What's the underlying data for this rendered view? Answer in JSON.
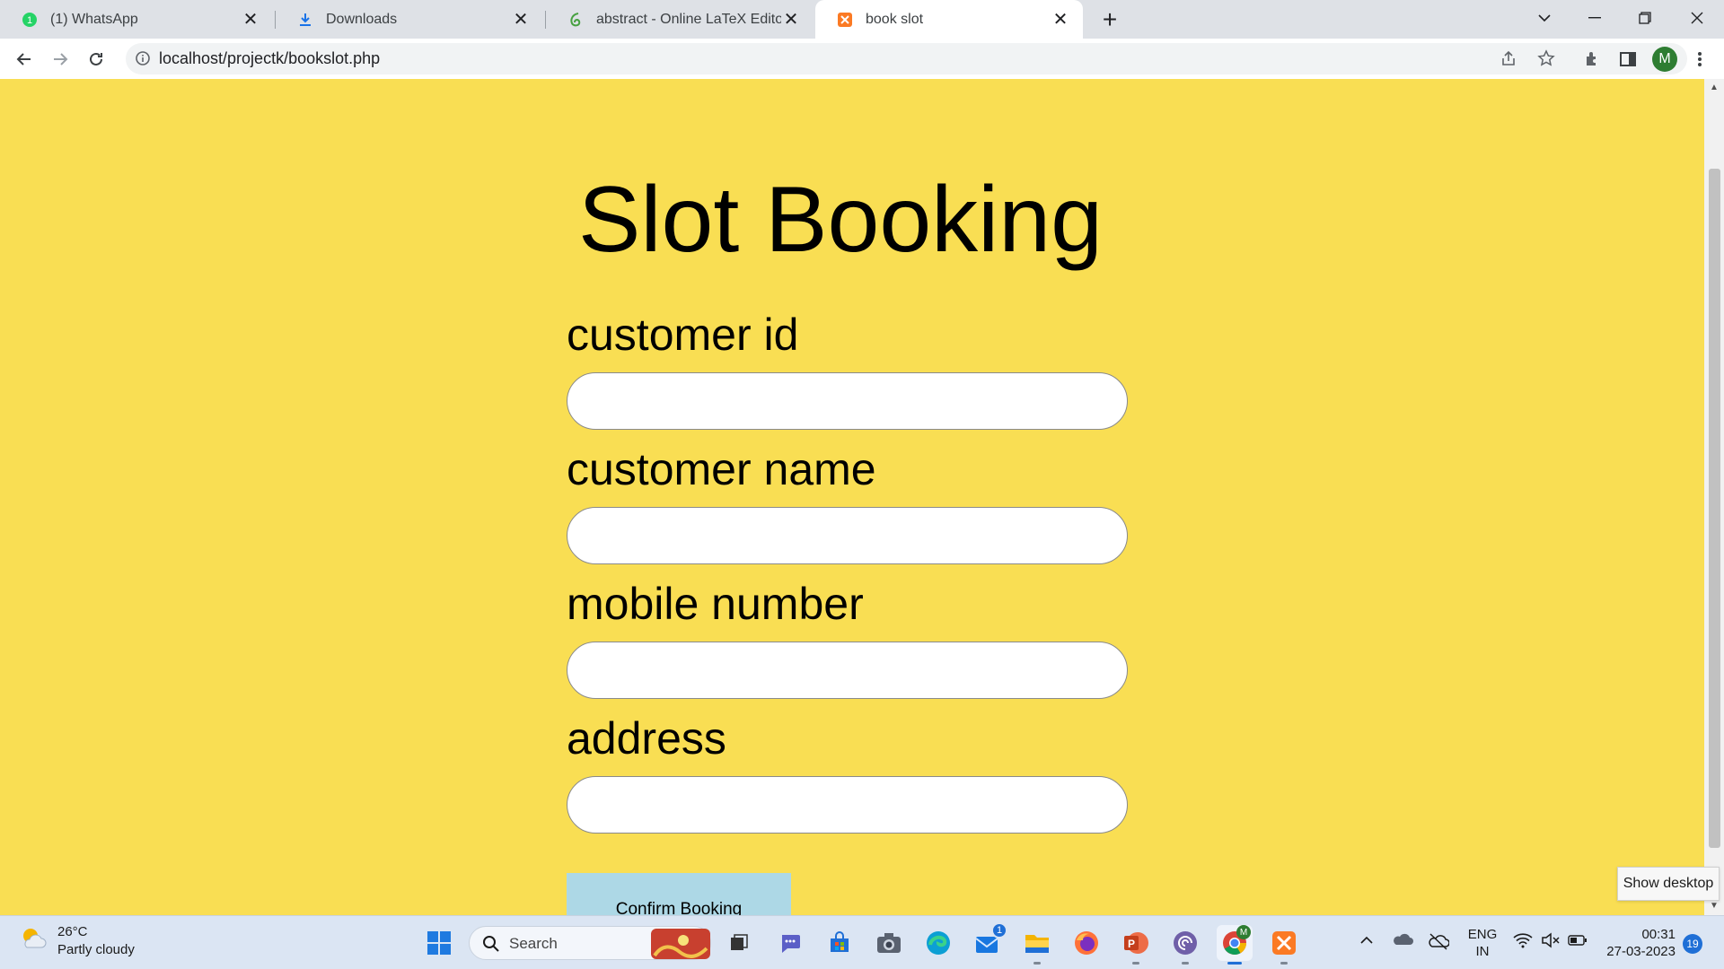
{
  "browser": {
    "tabs": [
      {
        "title": "(1) WhatsApp",
        "icon": "whatsapp-icon",
        "active": false
      },
      {
        "title": "Downloads",
        "icon": "download-icon",
        "active": false
      },
      {
        "title": "abstract - Online LaTeX Editor Ov",
        "icon": "overleaf-icon",
        "active": false
      },
      {
        "title": "book slot",
        "icon": "xampp-icon",
        "active": true
      }
    ],
    "url": "localhost/projectk/bookslot.php",
    "profile_initial": "M"
  },
  "page": {
    "title": "Slot Booking",
    "fields": [
      {
        "label": "customer id",
        "value": ""
      },
      {
        "label": "customer name",
        "value": ""
      },
      {
        "label": "mobile number",
        "value": ""
      },
      {
        "label": "address",
        "value": ""
      }
    ],
    "submit_label": "Confirm Booking",
    "colors": {
      "background": "#f9de53",
      "button": "#add8e6"
    }
  },
  "tooltip": "Show desktop",
  "taskbar": {
    "weather_temp": "26°C",
    "weather_desc": "Partly cloudy",
    "search_placeholder": "Search",
    "mail_badge": "1",
    "language_line1": "ENG",
    "language_line2": "IN",
    "time": "00:31",
    "date": "27-03-2023",
    "notification_count": "19"
  }
}
